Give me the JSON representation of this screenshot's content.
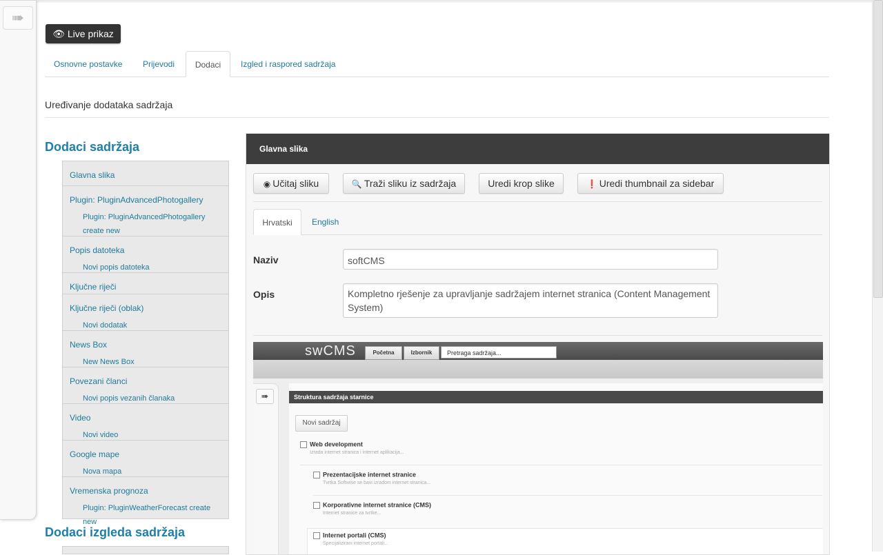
{
  "sidebar_toggle": {
    "icon": "arrow-right-icon"
  },
  "toolbar": {
    "live_label": "Live prikaz",
    "live_icon": "eye-icon"
  },
  "tabs": [
    {
      "label": "Osnovne postavke",
      "active": false
    },
    {
      "label": "Prijevodi",
      "active": false
    },
    {
      "label": "Dodaci",
      "active": true
    },
    {
      "label": "Izgled i raspored sadržaja",
      "active": false
    }
  ],
  "page_subtitle": "Uređivanje dodataka sadržaja",
  "addons": {
    "heading": "Dodaci sadržaja",
    "groups": [
      {
        "label": "Glavna slika",
        "sub": []
      },
      {
        "label": "Plugin: PluginAdvancedPhotogallery",
        "sub": [
          "Plugin: PluginAdvancedPhotogallery create new"
        ]
      },
      {
        "label": "Popis datoteka",
        "sub": [
          "Novi popis datoteka"
        ]
      },
      {
        "label": "Ključne riječi",
        "sub": []
      },
      {
        "label": "Ključne riječi (oblak)",
        "sub": [
          "Novi dodatak"
        ]
      },
      {
        "label": "News Box",
        "sub": [
          "New News Box"
        ]
      },
      {
        "label": "Povezani članci",
        "sub": [
          "Novi popis vezanih članaka"
        ]
      },
      {
        "label": "Video",
        "sub": [
          "Novi video"
        ]
      },
      {
        "label": "Google mape",
        "sub": [
          "Nova mapa"
        ]
      },
      {
        "label": "Vremenska prognoza",
        "sub": [
          "Plugin: PluginWeatherForecast create new"
        ]
      }
    ],
    "heading2": "Dodaci izgleda sadržaja"
  },
  "panel": {
    "title": "Glavna slika",
    "buttons": [
      {
        "label": "Učitaj sliku",
        "icon": "upload-circle-icon"
      },
      {
        "label": "Traži sliku iz sadržaja",
        "icon": "search-icon"
      },
      {
        "label": "Uredi krop slike",
        "icon": ""
      },
      {
        "label": "Uredi thumbnail za sidebar",
        "icon": "alert-circle-icon"
      }
    ],
    "lang_tabs": [
      {
        "label": "Hrvatski",
        "active": true
      },
      {
        "label": "English",
        "active": false
      }
    ],
    "fields": {
      "naziv_label": "Naziv",
      "naziv_value": "softCMS",
      "opis_label": "Opis",
      "opis_value": "Kompletno rješenje za upravljanje sadržajem internet stranica (Content Management System)"
    }
  },
  "preview": {
    "logo": "swCMS",
    "nav": [
      "Početna",
      "Izbornik"
    ],
    "search_placeholder": "Pretraga sadržaja...",
    "section_title": "Struktura sadržaja starnice",
    "new_button": "Novi sadržaj",
    "items": [
      {
        "title": "Web development",
        "desc": "Izrada internet stranica i internet aplikacija..."
      },
      {
        "title": "Prezentacijske internet stranice",
        "desc": "Tvrtka Softwise se bavi izradom internet stranica..."
      },
      {
        "title": "Korporativne internet stranice (CMS)",
        "desc": "Internet stranice za tvrtke..."
      },
      {
        "title": "Internet portali (CMS)",
        "desc": "Specijalizirani internet portali..."
      }
    ]
  }
}
